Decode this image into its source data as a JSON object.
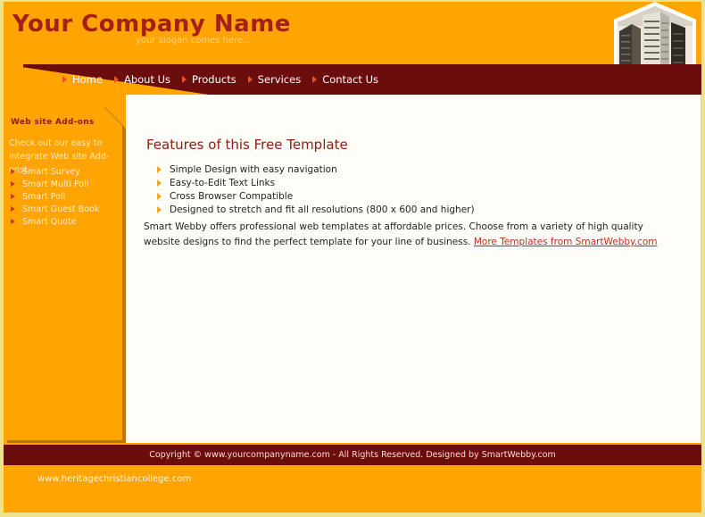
{
  "site": {
    "company_name": "Your Company Name",
    "slogan": "your slogan comes here...",
    "header_image": "city-skyscrapers-photo"
  },
  "nav": {
    "items": [
      {
        "label": "Home",
        "icon": "arrow-right-icon"
      },
      {
        "label": "About Us",
        "icon": "arrow-right-icon"
      },
      {
        "label": "Products",
        "icon": "arrow-right-icon"
      },
      {
        "label": "Services",
        "icon": "arrow-right-icon"
      },
      {
        "label": "Contact Us",
        "icon": "arrow-right-icon"
      }
    ]
  },
  "sidebar": {
    "title": "Web site Add-ons",
    "description": "Check out our easy to integrate Web site Add-ons!",
    "links": [
      {
        "label": "Smart Survey",
        "icon": "arrow-right-icon"
      },
      {
        "label": "Smart Multi Poll",
        "icon": "arrow-right-icon"
      },
      {
        "label": "Smart Poll",
        "icon": "arrow-right-icon"
      },
      {
        "label": "Smart Guest Book",
        "icon": "arrow-right-icon"
      },
      {
        "label": "Smart Quote",
        "icon": "arrow-right-icon"
      }
    ]
  },
  "main": {
    "title": "Features of this Free Template",
    "features": [
      {
        "label": "Simple Design with easy navigation",
        "icon": "arrow-right-icon"
      },
      {
        "label": "Easy-to-Edit Text Links",
        "icon": "arrow-right-icon"
      },
      {
        "label": "Cross Browser Compatible",
        "icon": "arrow-right-icon"
      },
      {
        "label": "Designed to stretch and fit all resolutions (800 x 600 and higher)",
        "icon": "arrow-right-icon"
      }
    ],
    "paragraph_part1": "Smart Webby offers professional web templates at affordable prices. Choose from a variety of high quality website designs to find the perfect template for your line of business. ",
    "paragraph_link": "More Templates from SmartWebby.com"
  },
  "footer": {
    "copyright": "Copyright © www.yourcompanyname.com - All Rights Reserved. Designed by SmartWebby.com",
    "bottom_url": "www.heritagechristiancollege.com"
  },
  "colors": {
    "orange": "#ffa400",
    "dark_red": "#6b0d0d",
    "heading_red": "#8c1d10",
    "border_yellow": "#efe08c",
    "content_bg": "#fffdf8",
    "link_red": "#b0331f"
  }
}
